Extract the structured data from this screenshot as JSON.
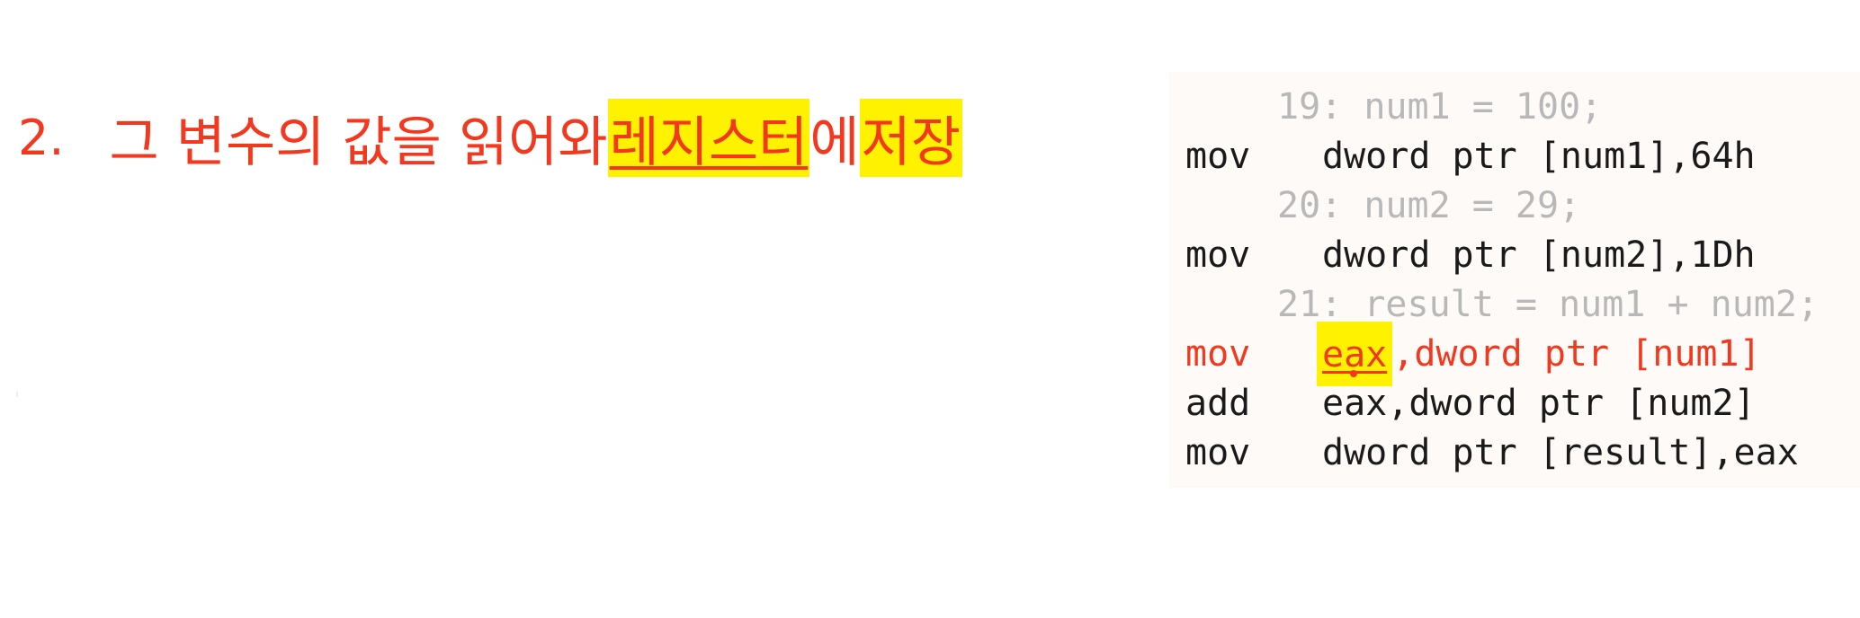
{
  "heading": {
    "number": "2.",
    "text_before": "그 변수의 값을 읽어와 ",
    "register_word": "레지스터",
    "particle": "에 ",
    "store_word": "저장"
  },
  "code": {
    "lines": [
      {
        "kind": "comment",
        "indent": "19: num1 = 100;"
      },
      {
        "kind": "instr",
        "mnemonic": "mov",
        "operands": "dword ptr [num1],64h"
      },
      {
        "kind": "comment",
        "indent": "20: num2 = 29;"
      },
      {
        "kind": "instr",
        "mnemonic": "mov",
        "operands": "dword ptr [num2],1Dh"
      },
      {
        "kind": "comment",
        "indent": "21: result = num1 + num2;"
      },
      {
        "kind": "hot",
        "mnemonic": "mov",
        "register": "eax",
        "operands_rest": ",dword ptr [num1]"
      },
      {
        "kind": "instr",
        "mnemonic": "add",
        "operands": "eax,dword ptr [num2]"
      },
      {
        "kind": "instr",
        "mnemonic": "mov",
        "operands": "dword ptr [result],eax"
      }
    ]
  },
  "colors": {
    "accent_red": "#f2391f",
    "highlight_yellow": "#fff200",
    "comment_gray": "#b8b8b8",
    "panel_bg": "#fdfaf8"
  }
}
